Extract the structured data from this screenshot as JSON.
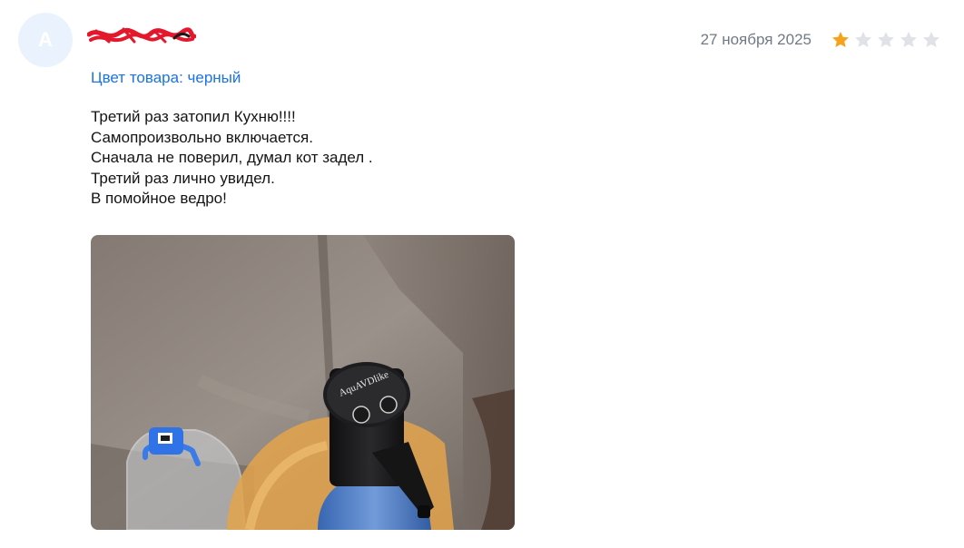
{
  "review": {
    "avatar_initial": "A",
    "date": "27 ноября 2025",
    "rating": 1,
    "rating_max": 5,
    "variant": "Цвет товара: черный",
    "text_lines": [
      "Третий раз затопил Кухню!!!!",
      "Самопроизвольно включается.",
      "Сначала не поверил, думал кот задел .",
      "Третий раз лично увидел.",
      "В помойное ведро!"
    ],
    "photo": {
      "brand_label": "AquAVDlike"
    }
  },
  "colors": {
    "star_filled": "#f7a21b",
    "star_empty": "#dfe3e8",
    "link": "#1a73e8",
    "avatar_bg": "#eaf3fd",
    "date": "#707a86"
  }
}
